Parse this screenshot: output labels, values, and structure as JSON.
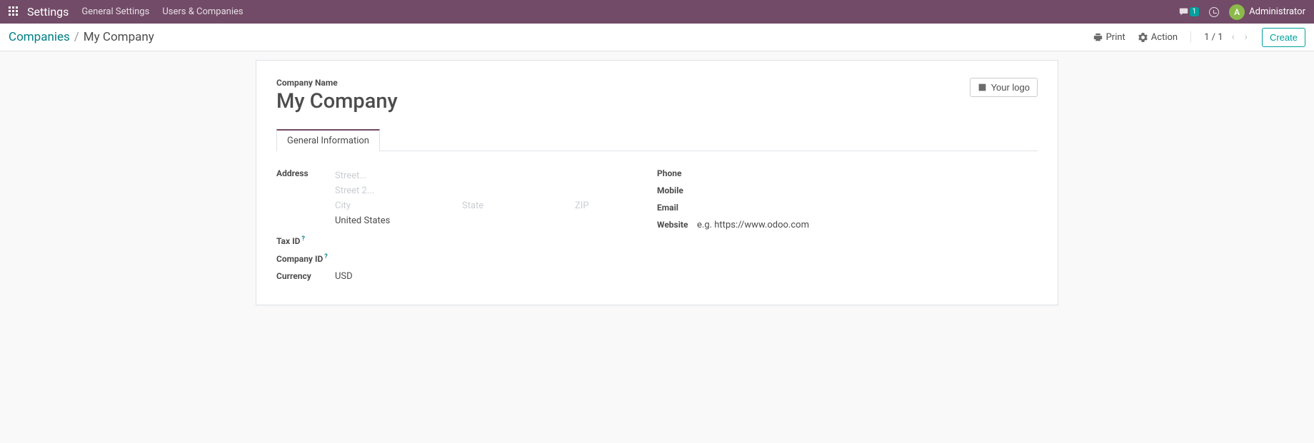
{
  "navbar": {
    "brand": "Settings",
    "links": [
      "General Settings",
      "Users & Companies"
    ],
    "chat_badge": "1",
    "user_initial": "A",
    "user_name": "Administrator"
  },
  "controlbar": {
    "breadcrumb_parent": "Companies",
    "breadcrumb_sep": "/",
    "breadcrumb_active": "My Company",
    "print_label": "Print",
    "action_label": "Action",
    "pager": "1 / 1",
    "create_label": "Create"
  },
  "form": {
    "company_name_label": "Company Name",
    "company_name": "My Company",
    "your_logo_label": "Your logo",
    "tab_general": "General Information",
    "labels": {
      "address": "Address",
      "tax_id": "Tax ID",
      "company_id": "Company ID",
      "currency": "Currency",
      "phone": "Phone",
      "mobile": "Mobile",
      "email": "Email",
      "website": "Website"
    },
    "help_mark": "?",
    "address": {
      "street_placeholder": "Street...",
      "street2_placeholder": "Street 2...",
      "city_placeholder": "City",
      "state_placeholder": "State",
      "zip_placeholder": "ZIP",
      "country": "United States"
    },
    "currency": "USD",
    "website_placeholder": "e.g. https://www.odoo.com"
  }
}
